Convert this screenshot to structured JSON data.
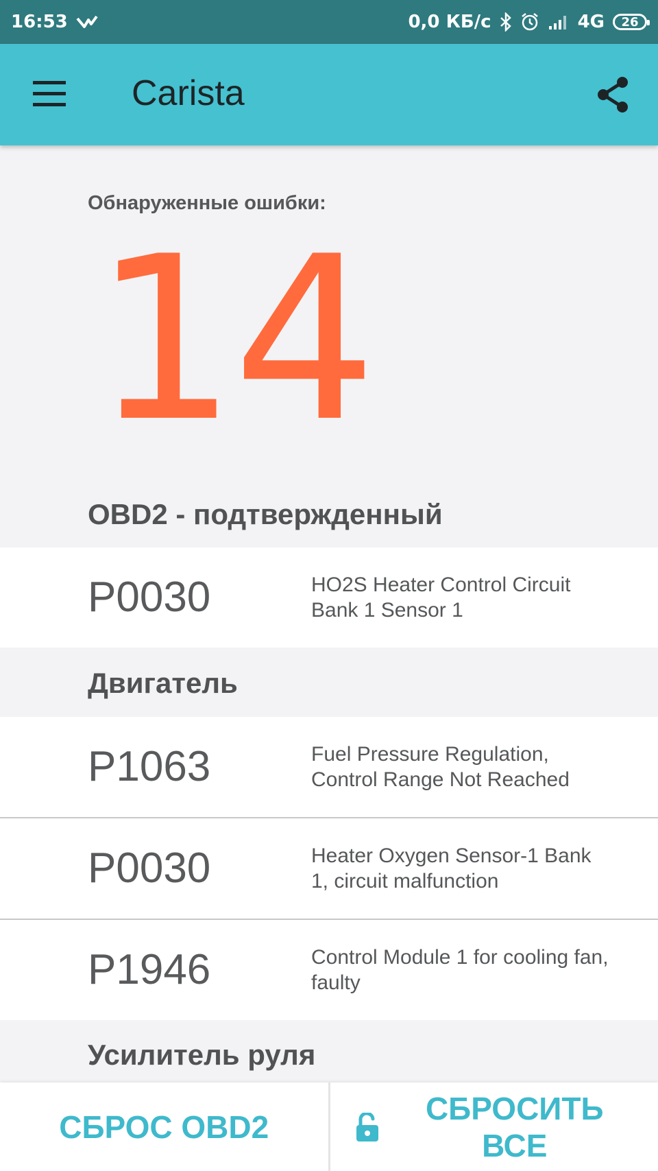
{
  "status_bar": {
    "time": "16:53",
    "speed": "0,0 КБ/с",
    "network": "4G",
    "battery": "26",
    "icons": [
      "messenger-icon",
      "bluetooth-icon",
      "alarm-icon",
      "signal-icon",
      "battery-icon"
    ]
  },
  "app_bar": {
    "title": "Carista",
    "icons": [
      "menu-icon",
      "share-icon"
    ]
  },
  "summary": {
    "label": "Обнаруженные ошибки:",
    "count": "14"
  },
  "sections": {
    "obd2": {
      "title": "OBD2 - подтвержденный",
      "rows": [
        {
          "code": "P0030",
          "desc": "HO2S Heater Control Circuit Bank 1 Sensor 1"
        }
      ]
    },
    "engine": {
      "title": "Двигатель",
      "rows": [
        {
          "code": "P1063",
          "desc": "Fuel Pressure Regulation, Control Range Not Reached"
        },
        {
          "code": "P0030",
          "desc": "Heater Oxygen Sensor-1 Bank 1, circuit malfunction"
        },
        {
          "code": "P1946",
          "desc": "Control Module 1 for cooling fan, faulty"
        }
      ]
    },
    "steering": {
      "title": "Усилитель руля"
    }
  },
  "bottom_bar": {
    "reset_obd2": "СБРОС OBD2",
    "reset_all": "СБРОСИТЬ ВСЕ",
    "icons": [
      "unlock-icon"
    ]
  },
  "colors": {
    "status_bar": "#2e7a7f",
    "app_bar": "#45c1d0",
    "error_count": "#ff6b3d",
    "action_text": "#3fb9cc",
    "background": "#f3f3f5"
  }
}
